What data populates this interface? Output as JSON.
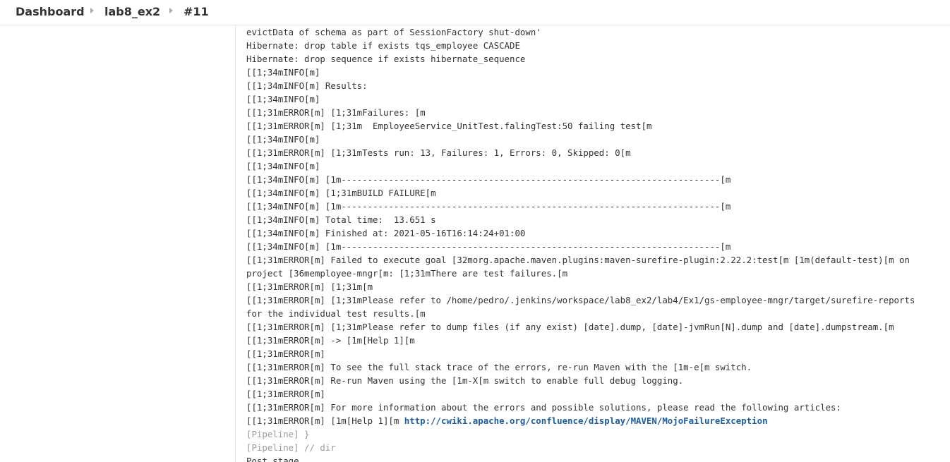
{
  "breadcrumb": {
    "items": [
      "Dashboard",
      "lab8_ex2",
      "#11"
    ]
  },
  "console": {
    "lines": [
      "evictData of schema as part of SessionFactory shut-down'",
      "Hibernate: drop table if exists tqs_employee CASCADE",
      "Hibernate: drop sequence if exists hibernate_sequence",
      "[[1;34mINFO[m]",
      "[[1;34mINFO[m] Results:",
      "[[1;34mINFO[m]",
      "[[1;31mERROR[m] [1;31mFailures: [m",
      "[[1;31mERROR[m] [1;31m  EmployeeService_UnitTest.falingTest:50 failing test[m",
      "[[1;34mINFO[m]",
      "[[1;31mERROR[m] [1;31mTests run: 13, Failures: 1, Errors: 0, Skipped: 0[m",
      "[[1;34mINFO[m]",
      "[[1;34mINFO[m] [1m------------------------------------------------------------------------[m",
      "[[1;34mINFO[m] [1;31mBUILD FAILURE[m",
      "[[1;34mINFO[m] [1m------------------------------------------------------------------------[m",
      "[[1;34mINFO[m] Total time:  13.651 s",
      "[[1;34mINFO[m] Finished at: 2021-05-16T16:14:24+01:00",
      "[[1;34mINFO[m] [1m------------------------------------------------------------------------[m",
      "[[1;31mERROR[m] Failed to execute goal [32morg.apache.maven.plugins:maven-surefire-plugin:2.22.2:test[m [1m(default-test)[m on",
      "project [36memployee-mngr[m: [1;31mThere are test failures.[m",
      "[[1;31mERROR[m] [1;31m[m",
      "[[1;31mERROR[m] [1;31mPlease refer to /home/pedro/.jenkins/workspace/lab8_ex2/lab4/Ex1/gs-employee-mngr/target/surefire-reports",
      "for the individual test results.[m",
      "[[1;31mERROR[m] [1;31mPlease refer to dump files (if any exist) [date].dump, [date]-jvmRun[N].dump and [date].dumpstream.[m",
      "[[1;31mERROR[m] -> [1m[Help 1][m",
      "[[1;31mERROR[m]",
      "[[1;31mERROR[m] To see the full stack trace of the errors, re-run Maven with the [1m-e[m switch.",
      "[[1;31mERROR[m] Re-run Maven using the [1m-X[m switch to enable full debug logging.",
      "[[1;31mERROR[m]",
      "[[1;31mERROR[m] For more information about the errors and possible solutions, please read the following articles:"
    ],
    "help_prefix": "[[1;31mERROR[m] [1m[Help 1][m ",
    "help_link": "http://cwiki.apache.org/confluence/display/MAVEN/MojoFailureException",
    "pipeline_lines": [
      "[Pipeline] }",
      "[Pipeline] // dir"
    ],
    "post_stage": "Post stage"
  }
}
